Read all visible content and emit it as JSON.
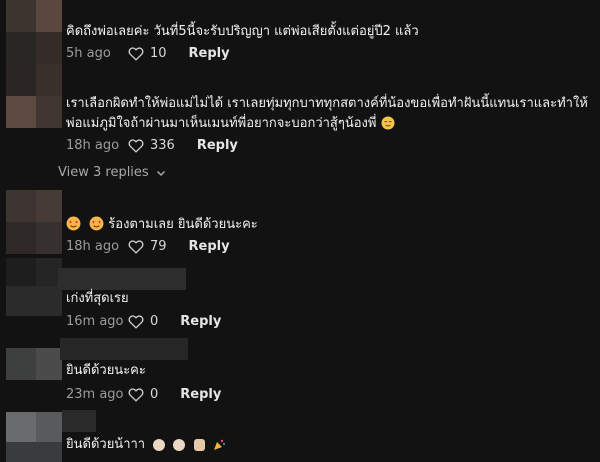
{
  "comments": [
    {
      "text": "คิดถึงพ่อเลยค่ะ วันที่5นี้จะรับปริญญา แต่พ่อเสียตั้งแต่อยู่ปี2 แล้ว",
      "time": "5h ago",
      "likes": "10",
      "reply": "Reply"
    },
    {
      "text_line1": "เราเลือกผิดทำให้พ่อแม่ไม่ได้ เราเลยทุ่มทุกบาททุกสตางค์ที่น้องขอเพื่อทำฝันนี้แทนเราและทำให้",
      "text_line2": "พ่อแม่ภูมิใจถ้าผ่านมาเห็นเมนท์พี่อยากจะบอกว่าสู้ๆน้องพี่",
      "time": "18h ago",
      "likes": "336",
      "reply": "Reply",
      "view_replies": "View 3 replies"
    },
    {
      "text": "ร้องตามเลย ยินดีด้วยนะคะ",
      "time": "18h ago",
      "likes": "79",
      "reply": "Reply"
    },
    {
      "text": "เก่งที่สุดเรย",
      "time": "16m ago",
      "likes": "0",
      "reply": "Reply"
    },
    {
      "text": "ยินดีด้วยนะคะ",
      "time": "23m ago",
      "likes": "0",
      "reply": "Reply"
    },
    {
      "text": "ยินดีด้วยน้าาา"
    }
  ],
  "icons": {
    "like": "heart-outline-icon",
    "expand": "chevron-down-icon",
    "emoji_smile": "relieved-face-emoji",
    "emoji_hearts": "smiling-face-with-hearts-emoji",
    "emoji_clap": "clapping-hands-emoji",
    "emoji_thumb": "thumbs-up-emoji",
    "emoji_party": "party-popper-emoji"
  },
  "colors": {
    "background": "#121212",
    "meta": "#9c9c9c",
    "text": "#f2f2f2"
  }
}
